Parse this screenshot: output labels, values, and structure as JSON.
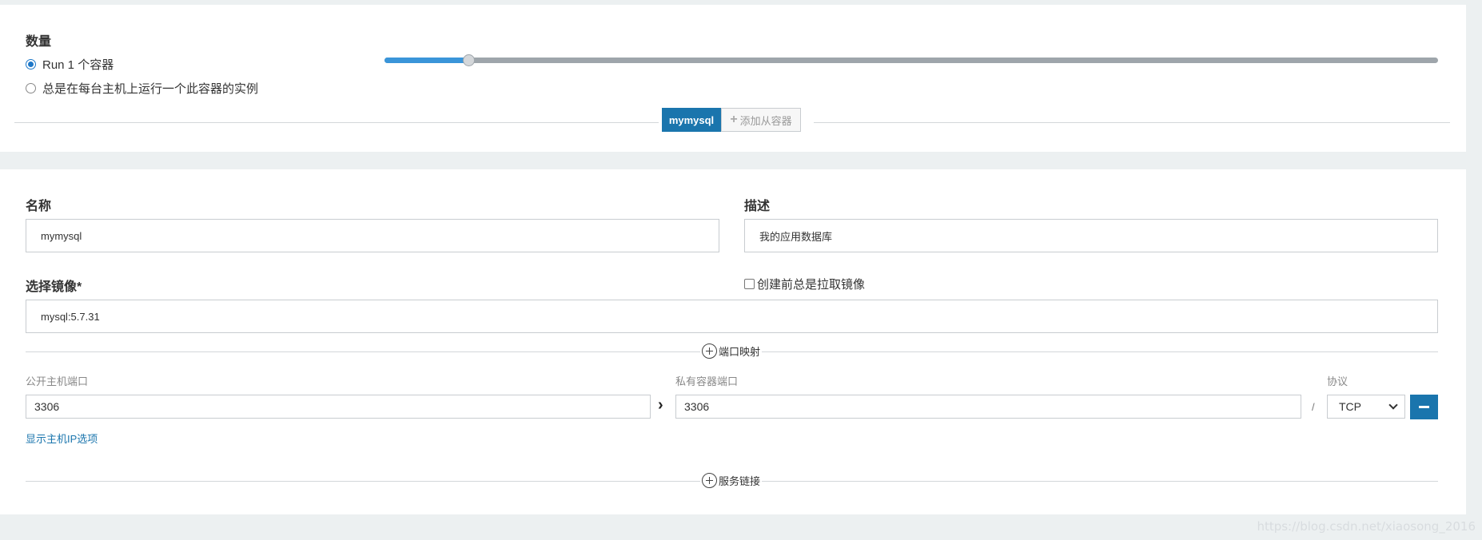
{
  "scale": {
    "title": "数量",
    "option_run_n": "Run 1 个容器",
    "option_global": "总是在每台主机上运行一个此容器的实例",
    "selected": "run_n",
    "slider_level_percent": 8
  },
  "container_tabs": {
    "active": "mymysql",
    "add_sidekick": "添加从容器"
  },
  "form": {
    "name_label": "名称",
    "name_value": "mymysql",
    "desc_label": "描述",
    "desc_value": "我的应用数据库",
    "image_label": "选择镜像*",
    "image_value": "mysql:5.7.31",
    "pull_label": "创建前总是拉取镜像"
  },
  "port_mapping": {
    "section_label": "端口映射",
    "public_label": "公开主机端口",
    "private_label": "私有容器端口",
    "protocol_label": "协议",
    "public_value": "3306",
    "private_value": "3306",
    "separator": "/",
    "protocol_value": "TCP",
    "show_ip_link": "显示主机IP选项"
  },
  "service_links": {
    "section_label": "服务链接"
  },
  "watermark": "https://blog.csdn.net/xiaosong_2016",
  "colors": {
    "accent": "#1a75ad",
    "slider_fill": "#3a95d9",
    "background": "#ecf0f1"
  },
  "icons": {
    "add_tab": "plus-icon",
    "section_add": "circle-plus-icon",
    "arrow": "chevron-right-icon",
    "remove": "minus-icon",
    "dropdown": "chevron-down-icon"
  }
}
